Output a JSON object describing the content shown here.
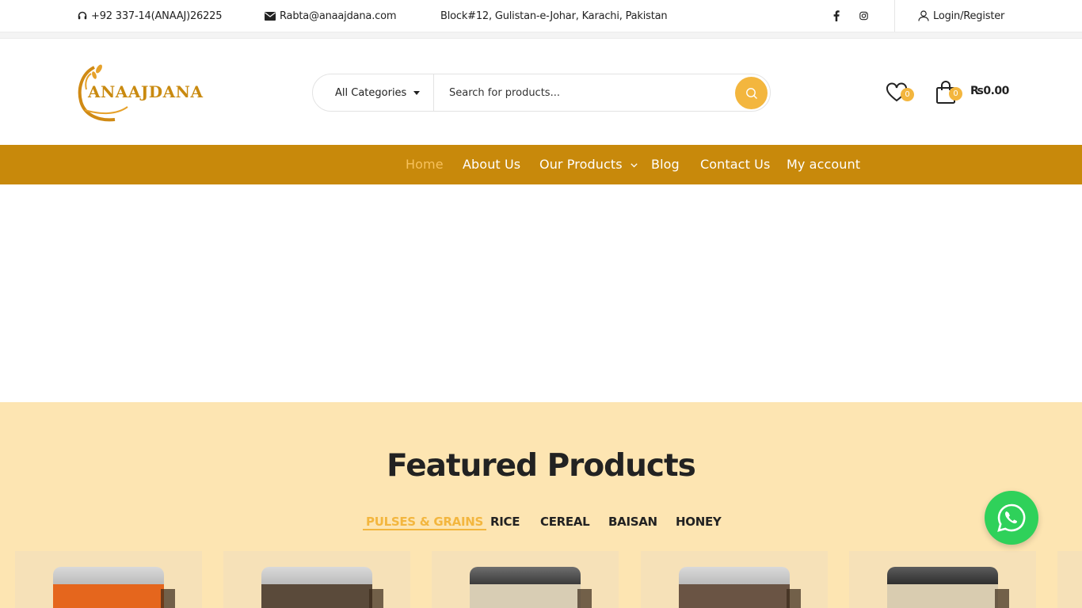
{
  "topbar": {
    "phone": "+92 337-14(ANAAJ)26225",
    "email": "Rabta@anaajdana.com",
    "address": "Block#12, Gulistan-e-Johar, Karachi, Pakistan",
    "login": "Login/Register",
    "social_icons": [
      "facebook-icon",
      "instagram-icon"
    ]
  },
  "header": {
    "logo_text": "ANAAJDANA",
    "search": {
      "category": "All Categories",
      "placeholder": "Search for products..."
    },
    "wishlist_count": "0",
    "cart_count": "0",
    "cart_total": "₨0.00"
  },
  "nav": {
    "items": [
      {
        "label": "Home",
        "active": true
      },
      {
        "label": "About Us"
      },
      {
        "label": "Our Products",
        "has_dropdown": true
      },
      {
        "label": "Blog"
      },
      {
        "label": "Contact Us"
      },
      {
        "label": "My account"
      }
    ]
  },
  "featured": {
    "title": "Featured Products",
    "tabs": [
      "PULSES & GRAINS",
      "RICE",
      "CEREAL",
      "BAISAN",
      "HONEY"
    ],
    "active_tab": "PULSES & GRAINS"
  },
  "colors": {
    "accent": "#f3b63e",
    "nav_bg": "#c8890b",
    "featured_bg": "#fde5b2",
    "whatsapp": "#2fd15a"
  }
}
